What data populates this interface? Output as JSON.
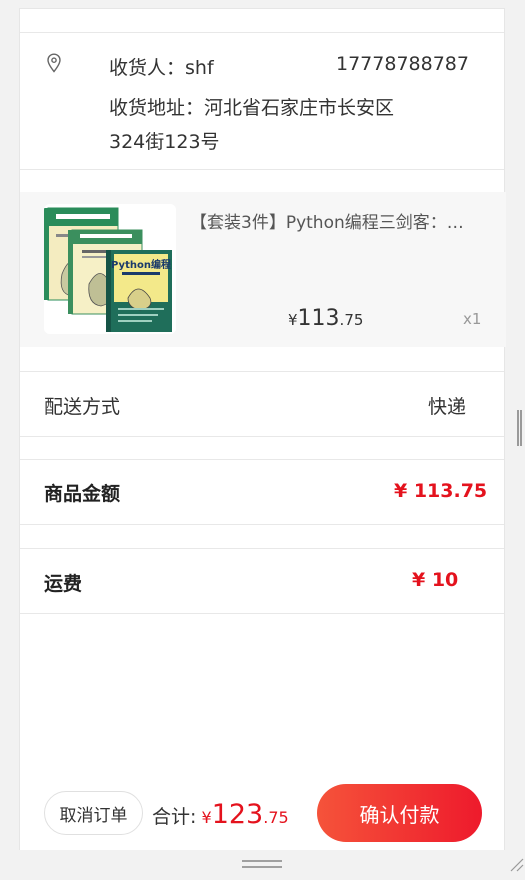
{
  "address": {
    "receiver_label": "收货人：",
    "receiver_name": "shf",
    "phone": "17778788787",
    "address_label": "收货地址：",
    "address_value": "河北省石家庄市长安区324街123号",
    "icon": "location-pin-icon"
  },
  "product": {
    "title": "【套装3件】Python编程三剑客：…",
    "price_currency": "¥",
    "price_integer": "113",
    "price_decimal": ".75",
    "quantity": "x1",
    "image_label": "Python编程"
  },
  "delivery": {
    "label": "配送方式",
    "value": "快递"
  },
  "goods_amount": {
    "label": "商品金额",
    "value": "¥ 113.75"
  },
  "shipping": {
    "label": "运费",
    "value": "¥ 10"
  },
  "footer": {
    "cancel_label": "取消订单",
    "total_label": "合计:",
    "total_currency": "¥",
    "total_integer": "123",
    "total_decimal": ".75",
    "confirm_label": "确认付款"
  },
  "colors": {
    "accent_red": "#e4121d",
    "button_gradient_start": "#f5533a",
    "button_gradient_end": "#ee1a2c"
  }
}
